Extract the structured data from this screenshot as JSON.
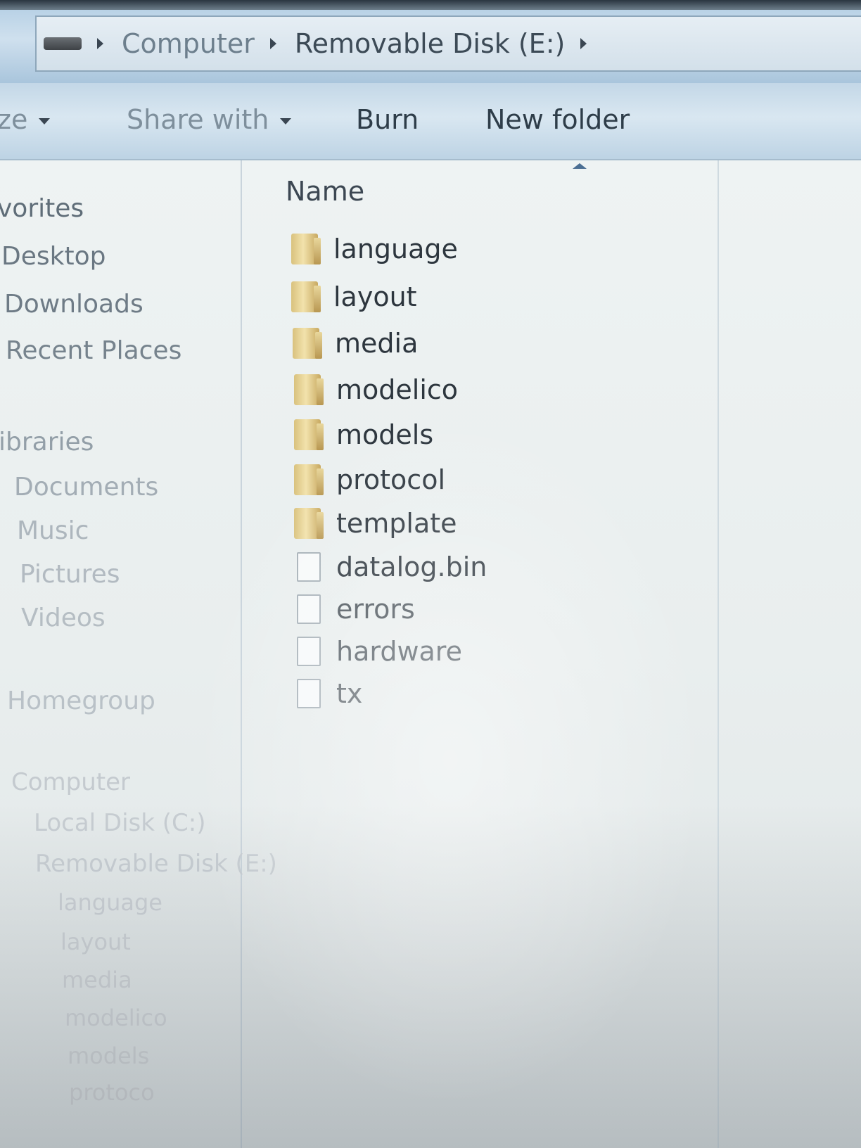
{
  "address_bar": {
    "crumbs": [
      "Computer",
      "Removable Disk (E:)"
    ]
  },
  "command_bar": {
    "organize": "ze",
    "share_with": "Share with",
    "burn": "Burn",
    "new_folder": "New folder"
  },
  "nav_pane": {
    "favorites": "vorites",
    "desktop": "Desktop",
    "downloads": "Downloads",
    "recent_places": "Recent Places",
    "libraries": "ibraries",
    "documents": "Documents",
    "music": "Music",
    "pictures": "Pictures",
    "videos": "Videos",
    "homegroup": "Homegroup",
    "computer": "Computer",
    "local_disk": "Local Disk (C:)",
    "removable_disk": "Removable Disk (E:)",
    "sub_language": "language",
    "sub_layout": "layout",
    "sub_media": "media",
    "sub_modelico": "modelico",
    "sub_models": "models",
    "sub_protocol": "protoco"
  },
  "file_list": {
    "column_name": "Name",
    "items": [
      {
        "name": "language",
        "type": "folder"
      },
      {
        "name": "layout",
        "type": "folder"
      },
      {
        "name": "media",
        "type": "folder"
      },
      {
        "name": "modelico",
        "type": "folder"
      },
      {
        "name": "models",
        "type": "folder"
      },
      {
        "name": "protocol",
        "type": "folder"
      },
      {
        "name": "template",
        "type": "folder"
      },
      {
        "name": "datalog.bin",
        "type": "file"
      },
      {
        "name": "errors",
        "type": "file"
      },
      {
        "name": "hardware",
        "type": "file"
      },
      {
        "name": "tx",
        "type": "file"
      }
    ]
  }
}
